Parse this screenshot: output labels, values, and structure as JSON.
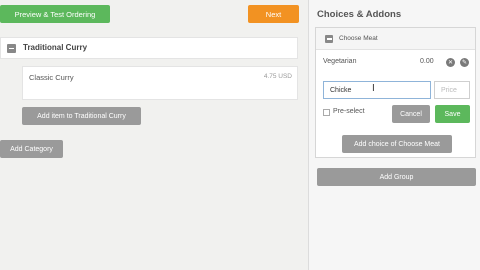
{
  "toolbar": {
    "preview_label": "Preview & Test Ordering",
    "next_label": "Next"
  },
  "category": {
    "name": "Traditional Curry",
    "items": [
      {
        "name": "Classic Curry",
        "price": "4.75 USD"
      }
    ],
    "add_item_label": "Add item to Traditional Curry"
  },
  "add_category_label": "Add Category",
  "addons": {
    "title": "Choices & Addons",
    "group": {
      "name": "Choose Meat",
      "choices": [
        {
          "name": "Vegetarian",
          "price": "0.00"
        }
      ],
      "new_choice": {
        "name_value": "Chicke",
        "price_placeholder": "Price",
        "preselect_label": "Pre-select",
        "cancel_label": "Cancel",
        "save_label": "Save"
      },
      "add_choice_label": "Add choice of Choose Meat"
    },
    "add_group_label": "Add Group"
  }
}
